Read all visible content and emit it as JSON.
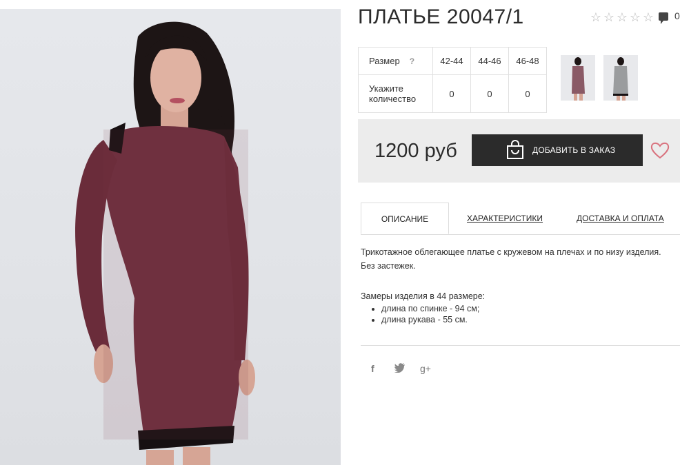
{
  "product": {
    "title": "ПЛАТЬЕ 20047/1",
    "rating_icon": "star-outline-icon",
    "comment_count": "0"
  },
  "size_table": {
    "size_label": "Размер",
    "help_mark": "?",
    "sizes": [
      "42-44",
      "44-46",
      "46-48"
    ],
    "qty_label_line1": "Укажите",
    "qty_label_line2": "количество",
    "quantities": [
      "0",
      "0",
      "0"
    ]
  },
  "purchase": {
    "price": "1200 руб",
    "add_button_label": "ДОБАВИТЬ В ЗАКАЗ"
  },
  "tabs": {
    "description": "ОПИСАНИЕ",
    "characteristics": "ХАРАКТЕРИСТИКИ",
    "delivery": "ДОСТАВКА И ОПЛАТА"
  },
  "description": {
    "line1": "Трикотажное облегающее платье с кружевом на плечах и по низу изделия.",
    "line2": "Без застежек.",
    "measures_title": "Замеры изделия в 44 размере:",
    "measures": [
      "длина по спинке - 94 см;",
      "длина рукава - 55 см."
    ]
  },
  "social": {
    "facebook": "f",
    "google_plus": "g+"
  },
  "colors": {
    "dress": "#6e2f3e",
    "button": "#2b2b2b",
    "heart": "#d9727e",
    "price_box": "#ececec"
  }
}
